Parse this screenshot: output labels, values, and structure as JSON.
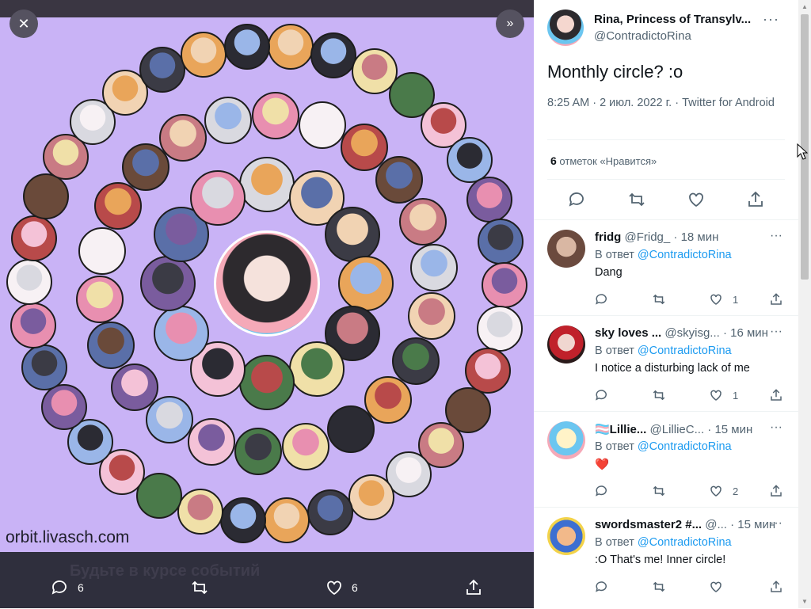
{
  "media": {
    "close_label": "✕",
    "expand_label": "»",
    "watermark": "orbit.livasch.com",
    "faint_caption": "Будьте в курсе событий",
    "actions": {
      "reply_count": "6",
      "like_count": "6"
    }
  },
  "tweet": {
    "author_name": "Rina, Princess of Transylv...",
    "author_handle": "@ContradictoRina",
    "text": "Monthly circle? :o",
    "meta": "8:25 AM · 2 июл. 2022 г. · Twitter for Android",
    "likes_count": "6",
    "likes_label": "отметок «Нравится»"
  },
  "replies": [
    {
      "name": "fridg",
      "handle": "@Fridg_ · 18 мин",
      "in_reply_prefix": "В ответ",
      "in_reply_to": "@ContradictoRina",
      "text": "Dang",
      "like_count": "1"
    },
    {
      "name": "sky loves ...",
      "handle": "@skyisg... · 16 мин",
      "in_reply_prefix": "В ответ",
      "in_reply_to": "@ContradictoRina",
      "text": "I notice a disturbing lack of me",
      "like_count": "1"
    },
    {
      "name": "🏳️‍⚧️Lillie...",
      "handle": "@LillieC... · 15 мин",
      "in_reply_prefix": "В ответ",
      "in_reply_to": "@ContradictoRina",
      "text": "❤️",
      "like_count": "2"
    },
    {
      "name": "swordsmaster2 #...",
      "handle": "@... · 15 мин",
      "in_reply_prefix": "В ответ",
      "in_reply_to": "@ContradictoRina",
      "text": ":O That's me! Inner circle!",
      "like_count": ""
    }
  ],
  "colors": {
    "accent": "#1d9bf0",
    "image_bg": "#c9b3f6",
    "media_bg": "#2f2f3d"
  }
}
